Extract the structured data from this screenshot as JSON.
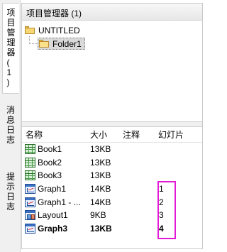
{
  "side_tabs": [
    {
      "label": "项目管理器 (1)"
    },
    {
      "label": "消息日志"
    },
    {
      "label": "提示日志"
    }
  ],
  "panel": {
    "title": "项目管理器 (1)"
  },
  "tree": {
    "root": "UNTITLED",
    "child": "Folder1"
  },
  "list": {
    "columns": {
      "name": "名称",
      "size": "大小",
      "note": "注释",
      "slide": "幻灯片"
    },
    "rows": [
      {
        "name": "Book1",
        "size": "13KB",
        "note": "",
        "slide": "",
        "icon": "book-icon"
      },
      {
        "name": "Book2",
        "size": "13KB",
        "note": "",
        "slide": "",
        "icon": "book-icon"
      },
      {
        "name": "Book3",
        "size": "13KB",
        "note": "",
        "slide": "",
        "icon": "book-icon"
      },
      {
        "name": "Graph1",
        "size": "14KB",
        "note": "",
        "slide": "1",
        "icon": "graph-icon"
      },
      {
        "name": "Graph1 - ...",
        "size": "14KB",
        "note": "",
        "slide": "2",
        "icon": "graph-icon"
      },
      {
        "name": "Layout1",
        "size": "9KB",
        "note": "",
        "slide": "3",
        "icon": "layout-icon"
      },
      {
        "name": "Graph3",
        "size": "13KB",
        "note": "",
        "slide": "4",
        "icon": "graph-icon",
        "bold": true
      }
    ]
  },
  "colors": {
    "highlight": "#e21ad6",
    "folder": "#f8d874",
    "book": "#2a6e2a",
    "graph": "#1f4f9a"
  }
}
